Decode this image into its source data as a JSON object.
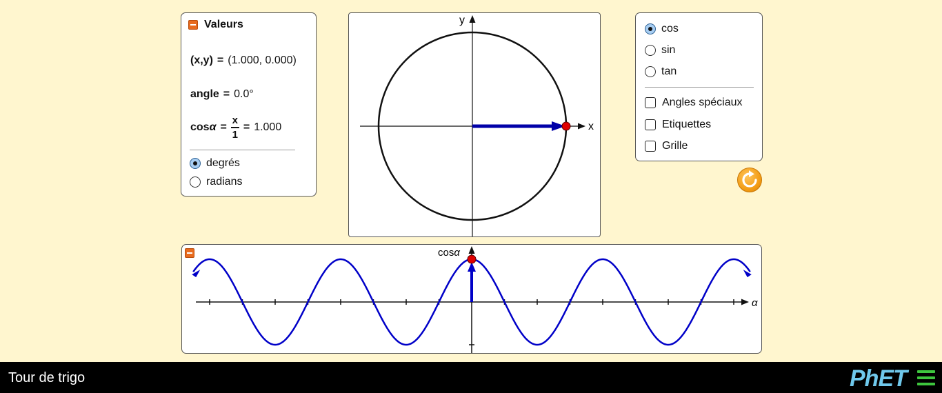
{
  "values_panel": {
    "title": "Valeurs",
    "xy_label": "(x,y)",
    "xy_value": "(1.000, 0.000)",
    "angle_label": "angle",
    "angle_value": "0.0°",
    "trig_label_prefix": "cos",
    "trig_label_symbol": "α",
    "frac_numerator": "x",
    "frac_denominator": "1",
    "trig_value": "1.000",
    "equals": "=",
    "units": [
      {
        "label": "degrés",
        "selected": true
      },
      {
        "label": "radians",
        "selected": false
      }
    ]
  },
  "unit_circle": {
    "x_axis_label": "x",
    "y_axis_label": "y",
    "angle_degrees": 0
  },
  "function_panel": {
    "functions": [
      {
        "label": "cos",
        "selected": true
      },
      {
        "label": "sin",
        "selected": false
      },
      {
        "label": "tan",
        "selected": false
      }
    ],
    "options": [
      {
        "label": "Angles spéciaux",
        "checked": false
      },
      {
        "label": "Etiquettes",
        "checked": false
      },
      {
        "label": "Grille",
        "checked": false
      }
    ]
  },
  "graph": {
    "y_axis_label_prefix": "cos",
    "y_axis_label_symbol": "α",
    "x_axis_label": "α"
  },
  "chart_data": {
    "type": "line",
    "series": [
      {
        "values_function": "cos"
      }
    ],
    "x_range_turns": [
      -2.125,
      2.125
    ],
    "ylim": [
      -1,
      1
    ],
    "marker": {
      "x": 0,
      "y": 1
    }
  },
  "footer": {
    "sim_title": "Tour de trigo",
    "logo_text": "PhET"
  },
  "colors": {
    "background": "#fff6cf",
    "curve": "#0000c8",
    "marker": "#e00000",
    "accent": "#e86b1e"
  }
}
